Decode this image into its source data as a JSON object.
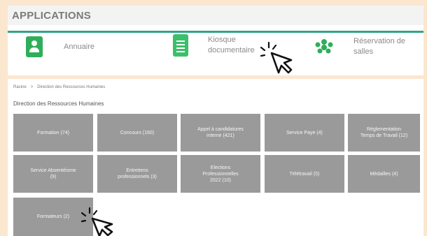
{
  "header": {
    "title": "APPLICATIONS"
  },
  "apps": [
    {
      "label": "Annuaire",
      "icon": "contact-book-icon"
    },
    {
      "label_line1": "Kiosque",
      "label_line2": "documentaire",
      "icon": "document-icon"
    },
    {
      "label_line1": "Réservation de",
      "label_line2": "salles",
      "icon": "group-icon"
    }
  ],
  "breadcrumb": {
    "root": "Racine",
    "separator": ">",
    "current": "Direction des Ressources Humaines"
  },
  "section": {
    "title": "Direction des Ressources Humaines"
  },
  "tiles": [
    {
      "lines": [
        "Formation (74)"
      ]
    },
    {
      "lines": [
        "Concours (160)"
      ]
    },
    {
      "lines": [
        "Appel à candidatures",
        "interne (421)"
      ]
    },
    {
      "lines": [
        "Service Paye (4)"
      ]
    },
    {
      "lines": [
        "Réglementation",
        "Temps de Travail (12)"
      ]
    },
    {
      "lines": [
        "Service Absentéisme",
        "(9)"
      ]
    },
    {
      "lines": [
        "Entretiens",
        "professionnels (3)"
      ]
    },
    {
      "lines": [
        "Elections",
        "Professionnelles",
        "2022 (10)"
      ]
    },
    {
      "lines": [
        "Télétravail (5)"
      ]
    },
    {
      "lines": [
        "Médailles (4)"
      ]
    },
    {
      "lines": [
        "Formateurs (2)"
      ]
    }
  ],
  "colors": {
    "background": "#fbe6cf",
    "accent": "#2fa58a",
    "app_icon_green": "#2fae5a",
    "tile_gray": "#9a9a9a"
  }
}
